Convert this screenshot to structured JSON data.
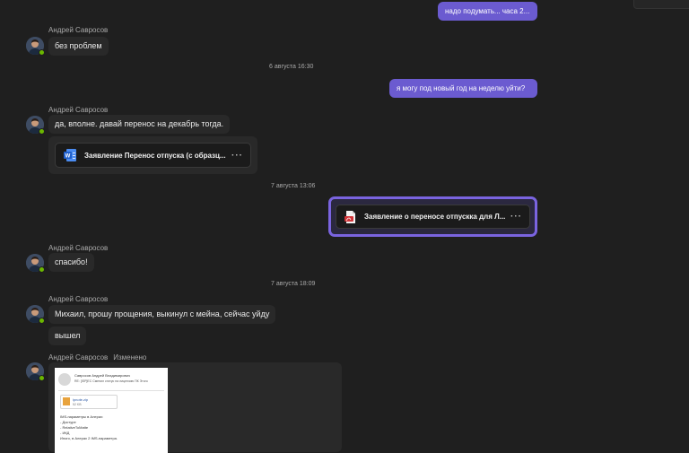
{
  "sender_name": "Андрей Савросов",
  "edited_label": "Изменено",
  "messages": {
    "out1": "надо подумать... часа 2...",
    "in1": "без проблем",
    "date1": "6 августа 16:30",
    "out2": "я могу под новый год на неделю уйти?",
    "in2": "да, вполне. давай перенос на декабрь тогда.",
    "file1": "Заявление Перенос отпуска (с образц...",
    "date2": "7 августа 13:06",
    "file2": "Заявление о переносе отпускка для Л...",
    "in3": "спасибо!",
    "date3": "7 августа 18:09",
    "in4": "Михаил, прошу прощения, выкинул с мейна, сейчас уйду",
    "in5": "вышел"
  },
  "file_menu": "···",
  "preview": {
    "header_line1": "Савросов Андрей Владимирович",
    "header_line2": "RE: [ISP]ЕС Сменил статус на лицензию ПК Этого ",
    "att_name": "ipnote.zip",
    "att_size": "52 KB",
    "body": [
      "IMS-параметры в Алерах:",
      "- Достуре",
      "- RelativeToMatte",
      "- ИКД",
      "",
      "Иного, в Алерах 2 IMS-параметра."
    ]
  },
  "colors": {
    "background": "#1f1f1f",
    "outgoing": "#6b5bd0",
    "incoming": "#292929",
    "selected_border": "#7a64e0",
    "presence": "#6bb700"
  }
}
